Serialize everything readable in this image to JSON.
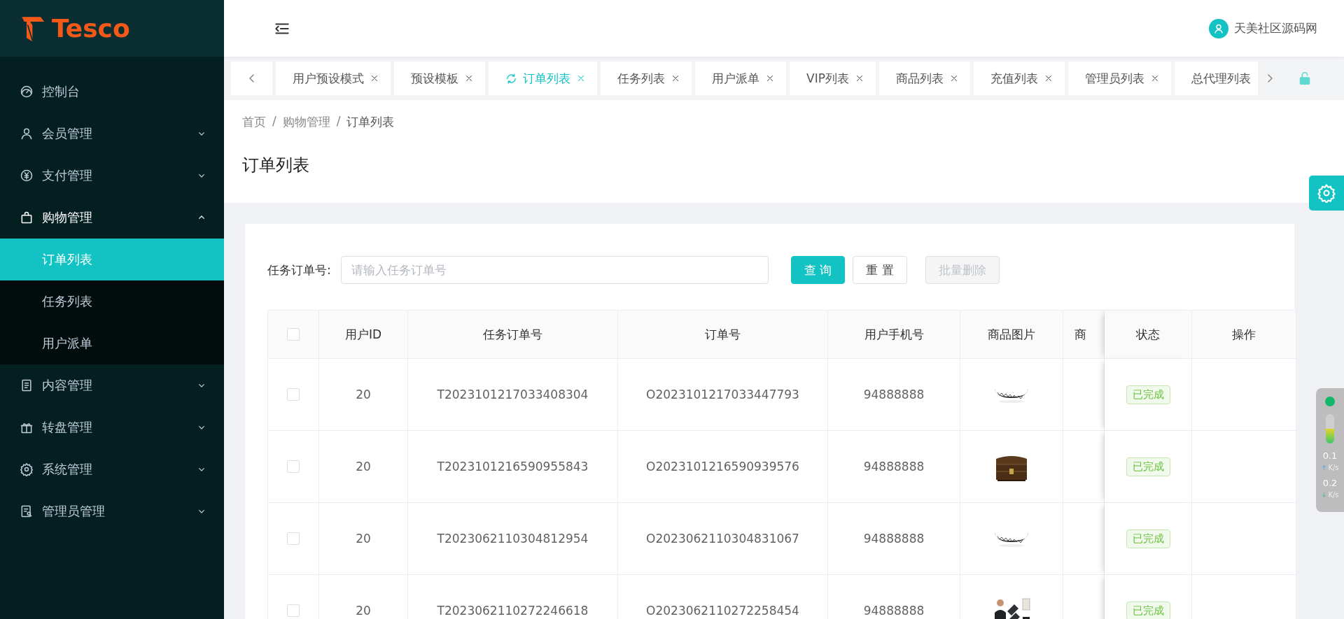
{
  "sidebar": {
    "logo": "Tesco",
    "items": [
      {
        "label": "控制台",
        "kind": "link"
      },
      {
        "label": "会员管理",
        "kind": "group",
        "expanded": false
      },
      {
        "label": "支付管理",
        "kind": "group",
        "expanded": false
      },
      {
        "label": "购物管理",
        "kind": "group",
        "expanded": true,
        "children": [
          {
            "label": "订单列表",
            "selected": true
          },
          {
            "label": "任务列表",
            "selected": false
          },
          {
            "label": "用户派单",
            "selected": false
          }
        ]
      },
      {
        "label": "内容管理",
        "kind": "group",
        "expanded": false
      },
      {
        "label": "转盘管理",
        "kind": "group",
        "expanded": false
      },
      {
        "label": "系统管理",
        "kind": "group",
        "expanded": false
      },
      {
        "label": "管理员管理",
        "kind": "group",
        "expanded": false
      }
    ]
  },
  "header": {
    "user_name": "天美社区源码网"
  },
  "tabs": [
    {
      "label": "用户预设模式",
      "selected": false,
      "closable": true
    },
    {
      "label": "预设模板",
      "selected": false,
      "closable": true
    },
    {
      "label": "订单列表",
      "selected": true,
      "closable": true
    },
    {
      "label": "任务列表",
      "selected": false,
      "closable": true
    },
    {
      "label": "用户派单",
      "selected": false,
      "closable": true
    },
    {
      "label": "VIP列表",
      "selected": false,
      "closable": true
    },
    {
      "label": "商品列表",
      "selected": false,
      "closable": true
    },
    {
      "label": "充值列表",
      "selected": false,
      "closable": true
    },
    {
      "label": "管理员列表",
      "selected": false,
      "closable": true
    },
    {
      "label": "总代理列表",
      "selected": false,
      "closable": false
    }
  ],
  "breadcrumb": {
    "separator": "/",
    "items": [
      "首页",
      "购物管理",
      "订单列表"
    ]
  },
  "page_title": "订单列表",
  "search": {
    "label": "任务订单号:",
    "placeholder": "请输入任务订单号",
    "buttons": [
      {
        "label": "查 询",
        "kind": "primary",
        "disabled": false
      },
      {
        "label": "重 置",
        "kind": "default",
        "disabled": false
      },
      {
        "label": "批量删除",
        "kind": "default",
        "disabled": true
      }
    ]
  },
  "table": {
    "all_selected": false,
    "columns": [
      "用户ID",
      "任务订单号",
      "订单号",
      "用户手机号",
      "商品图片",
      "商",
      "状态",
      "操作"
    ],
    "rows": [
      {
        "selected": false,
        "user_id": "20",
        "task_order_no": "T2023101217033408304",
        "order_no": "O2023101217033447793",
        "phone": "94888888",
        "status": "已完成"
      },
      {
        "selected": false,
        "user_id": "20",
        "task_order_no": "T2023101216590955843",
        "order_no": "O2023101216590939576",
        "phone": "94888888",
        "status": "已完成"
      },
      {
        "selected": false,
        "user_id": "20",
        "task_order_no": "T2023062110304812954",
        "order_no": "O2023062110304831067",
        "phone": "94888888",
        "status": "已完成"
      },
      {
        "selected": false,
        "user_id": "20",
        "task_order_no": "T2023062110272246618",
        "order_no": "O2023062110272258454",
        "phone": "94888888",
        "status": "已完成"
      }
    ]
  },
  "speed_monitor": {
    "upload": "0.1",
    "upload_unit": "K/s",
    "download": "0.2",
    "download_unit": "K/s"
  }
}
